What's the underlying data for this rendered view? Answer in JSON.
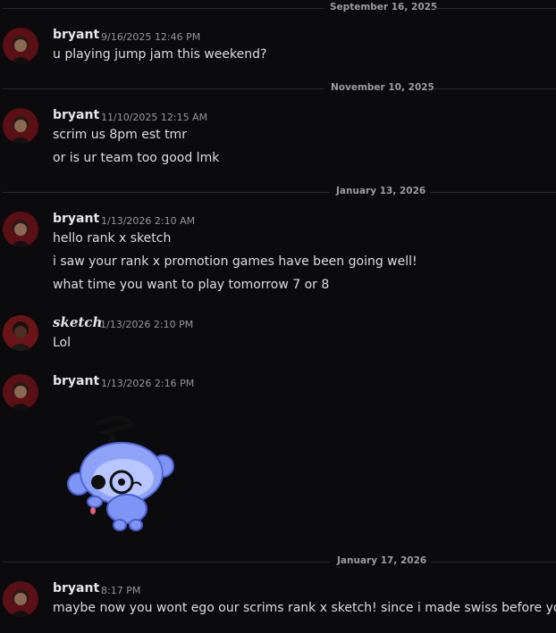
{
  "colors": {
    "background": "#0b0b0d",
    "divider": "#2a2b30",
    "username": "#e6e7ea",
    "timestamp": "#94979e",
    "text": "#dbdee1",
    "sticker_blue": "#7f95f5"
  },
  "dividers": [
    "September 16, 2025",
    "November 10, 2025",
    "January 13, 2026",
    "January 17, 2026"
  ],
  "messages": [
    {
      "author": "bryant",
      "timestamp": "9/16/2025 12:46 PM",
      "lines": [
        "u playing jump jam this weekend?"
      ]
    },
    {
      "author": "bryant",
      "timestamp": "11/10/2025 12:15 AM",
      "lines": [
        "scrim us 8pm est tmr",
        "or is ur team too good lmk"
      ]
    },
    {
      "author": "bryant",
      "timestamp": "1/13/2026 2:10 AM",
      "lines": [
        "hello rank x sketch",
        "i saw your rank x promotion games have been going well!",
        "what time you want to play tomorrow 7 or 8"
      ]
    },
    {
      "author": "sketch",
      "timestamp": "1/13/2026 2:10 PM",
      "lines": [
        "Lol"
      ]
    },
    {
      "author": "bryant",
      "timestamp": "1/13/2026 2:16 PM",
      "lines": [],
      "sticker": "blue-monocle-robot-sticker"
    },
    {
      "author": "bryant",
      "timestamp": "8:17 PM",
      "lines": [
        "maybe now you wont ego our scrims rank x sketch! since i made swiss before you"
      ]
    }
  ]
}
